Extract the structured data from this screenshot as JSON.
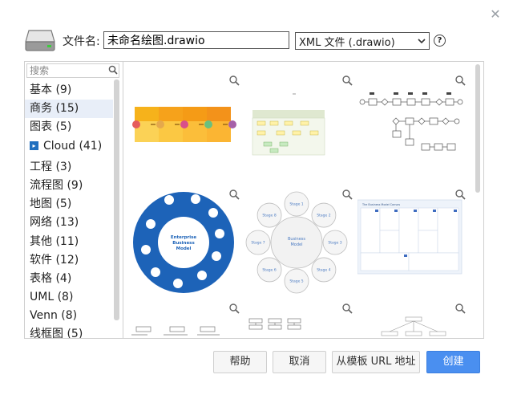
{
  "dialog": {
    "filename_label": "文件名:",
    "filename_value": "未命名绘图.drawio",
    "format_value": "XML 文件 (.drawio)",
    "help_icon": "question-circle-icon",
    "close_icon": "close-icon"
  },
  "search": {
    "placeholder": "搜索"
  },
  "categories": [
    {
      "label": "基本 (9)",
      "selected": false
    },
    {
      "label": "商务 (15)",
      "selected": true
    },
    {
      "label": "图表 (5)",
      "selected": false
    },
    {
      "label": "Cloud (41)",
      "selected": false
    },
    {
      "label": "工程 (3)",
      "selected": false
    },
    {
      "label": "流程图 (9)",
      "selected": false
    },
    {
      "label": "地图 (5)",
      "selected": false
    },
    {
      "label": "网络 (13)",
      "selected": false
    },
    {
      "label": "其他 (11)",
      "selected": false
    },
    {
      "label": "软件 (12)",
      "selected": false
    },
    {
      "label": "表格 (4)",
      "selected": false
    },
    {
      "label": "UML (8)",
      "selected": false
    },
    {
      "label": "Venn (8)",
      "selected": false
    },
    {
      "label": "线框图 (5)",
      "selected": false
    }
  ],
  "templates": {
    "enterprise": {
      "title": "Enterprise Business Model",
      "labels": [
        "Global Partnerships",
        "Environmental Awareness",
        "Finance",
        "Digital Development",
        "Customer Service",
        "Infrastructure",
        "Technology Certification",
        "Community",
        "Central Management Service",
        "Research Group"
      ]
    },
    "stages": {
      "center": "Business Model",
      "labels": [
        "Stage 1",
        "Stage 2",
        "Stage 3",
        "Stage 4",
        "Stage 5",
        "Stage 6",
        "Stage 7",
        "Stage 8"
      ]
    },
    "canvas": {
      "title": "The Business Model Canvas"
    }
  },
  "buttons": {
    "help": "帮助",
    "cancel": "取消",
    "from_url": "从模板 URL 地址",
    "create": "创建"
  },
  "colors": {
    "primary": "#4a8ff0",
    "selected_bg": "#e8eef8",
    "enterprise_blue": "#1d63b8",
    "chevron_yellow": "#f7c221"
  }
}
